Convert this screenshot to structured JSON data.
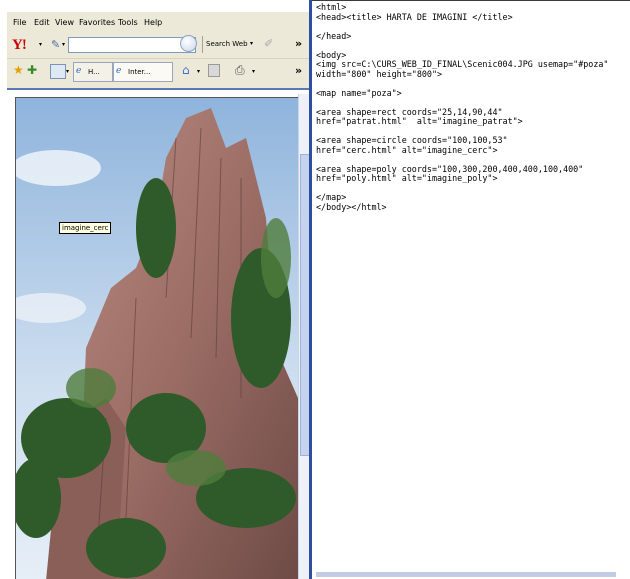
{
  "menu": [
    "File",
    "Edit",
    "View",
    "Favorites",
    "Tools",
    "Help"
  ],
  "toolbar": {
    "yahoo_logo": "Y!",
    "search_web_label": "Search Web",
    "tabs": [
      "H...",
      "Inter..."
    ]
  },
  "image_map": {
    "tooltip": "imagine_cerc"
  },
  "source_code": [
    "<html>",
    "<head><title> HARTA DE IMAGINI </title>",
    "",
    "</head>",
    "",
    "<body>",
    "<img src=C:\\CURS_WEB_ID_FINAL\\Scenic004.JPG usemap=\"#poza\"",
    "width=\"800\" height=\"800\">",
    "",
    "<map name=\"poza\">",
    "",
    "<area shape=rect coords=\"25,14,90,44\"",
    "href=\"patrat.html\"  alt=\"imagine_patrat\">",
    "",
    "<area shape=circle coords=\"100,100,53\"",
    "href=\"cerc.html\" alt=\"imagine_cerc\">",
    "",
    "<area shape=poly coords=\"100,300,200,400,400,100,400\"",
    "href=\"poly.html\" alt=\"imagine_poly\">",
    "",
    "</map>",
    "</body></html>"
  ],
  "icons": {
    "pencil": "pencil-icon",
    "favorites_star": "star-icon",
    "add_favorite": "add-favorite-icon",
    "home": "home-icon",
    "print": "printer-icon"
  }
}
